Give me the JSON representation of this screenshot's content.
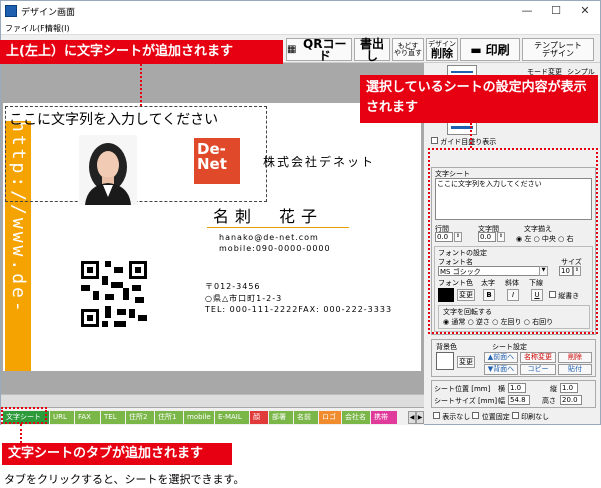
{
  "window": {
    "title": "デザイン画面",
    "controls": [
      "—",
      "☐",
      "✕"
    ]
  },
  "menu": [
    "ファイル(F)",
    "情報(I)"
  ],
  "toolbar": {
    "qr": "QRコード",
    "print_write": "書出し",
    "undo_line1": "もどす",
    "undo_line2": "やり直す",
    "delete_line1": "デザイン",
    "delete_line2": "削除",
    "print": "印刷",
    "template_line1": "テンプレート",
    "template_line2": "デザイン"
  },
  "card": {
    "text_sheet": "ここに文字列を入力してください",
    "url": "http://www.de-net.c",
    "logo_line1": "De-",
    "logo_line2": "Net",
    "logo_small": "DE-NET",
    "company": "株式会社デネット",
    "title_prefix": "…",
    "name": "名刺　花子",
    "email": "hanako@de-net.com",
    "mobile": "mobile:090-0000-0000",
    "zip": "〒012-3456",
    "address": "○県△市口町1-2-3",
    "tel": "TEL: 000-111-2222FAX: 000-222-3333"
  },
  "tabs": [
    {
      "label": "文字シート",
      "color": "#2e9b3a"
    },
    {
      "label": "URL",
      "color": "#7ab648"
    },
    {
      "label": "FAX",
      "color": "#7ab648"
    },
    {
      "label": "TEL",
      "color": "#7ab648"
    },
    {
      "label": "住所2",
      "color": "#7ab648"
    },
    {
      "label": "住所1",
      "color": "#7ab648"
    },
    {
      "label": "mobile",
      "color": "#7ab648"
    },
    {
      "label": "E-MAIL",
      "color": "#7ab648"
    },
    {
      "label": "顔",
      "color": "#e03a3a"
    },
    {
      "label": "部署",
      "color": "#7ab648"
    },
    {
      "label": "名前",
      "color": "#7ab648"
    },
    {
      "label": "ロゴ",
      "color": "#f08c2e"
    },
    {
      "label": "会社名",
      "color": "#7ab648"
    },
    {
      "label": "携帯",
      "color": "#e03a9a"
    }
  ],
  "right_panel": {
    "mode_label": "モード変更",
    "simple_label": "シンプル",
    "guide_label": "ガイド目盛り表示",
    "text_sheet_group": "文字シート",
    "text_value": "ここに文字列を入力してください",
    "line_spacing": "行間",
    "line_spacing_val": "0.0",
    "char_spacing": "文字間",
    "char_spacing_val": "0.0",
    "align_label": "文字揃え",
    "align_left": "左",
    "align_center": "中央",
    "align_right": "右",
    "font_setting": "フォントの設定",
    "font_name_label": "フォント名",
    "size_label": "サイズ",
    "font_name": "MS ゴシック",
    "size_val": "10",
    "font_color_label": "フォント色",
    "bold_label": "太字",
    "italic_label": "斜体",
    "underline_label": "下線",
    "change_label": "変更",
    "bold": "B",
    "italic": "I",
    "underline": "U",
    "vertical": "縦書き",
    "rotate_label": "文字を回転する",
    "rot_normal": "通常",
    "rot_reverse": "逆さ",
    "rot_left": "左回り",
    "rot_right": "右回り",
    "bg_color": "背景色",
    "sheet_setting": "シート設定",
    "change2": "変更",
    "front": "▲前面へ",
    "rename": "名称変更",
    "remove": "削除",
    "back": "▼背面へ",
    "copy": "コピー",
    "paste": "貼付",
    "sheet_pos": "シート位置 [mm]",
    "pos_x_label": "横",
    "pos_x": "1.0",
    "pos_y_label": "縦",
    "pos_y": "1.0",
    "sheet_size": "シートサイズ [mm]",
    "width_label": "幅",
    "width": "54.8",
    "height_label": "高さ",
    "height": "20.0",
    "hide": "表示なし",
    "lock_pos": "位置固定",
    "no_print": "印刷なし"
  },
  "callouts": {
    "top": "上(左上）に文字シートが追加されます",
    "right": "選択しているシートの設定内容が表示されます",
    "bottom": "文字シートのタブが追加されます",
    "caption": "タブをクリックすると、シートを選択できます。"
  }
}
